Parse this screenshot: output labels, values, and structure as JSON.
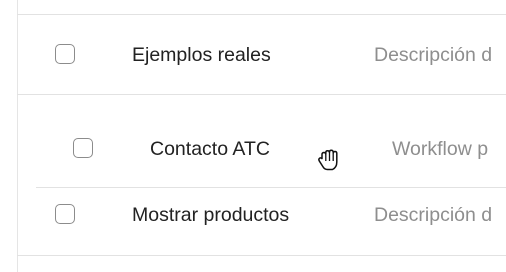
{
  "rows": [
    {
      "title": "Ejemplos reales",
      "description": "Descripción d"
    },
    {
      "title": "Contacto ATC",
      "description": "Workflow p"
    },
    {
      "title": "Mostrar productos",
      "description": "Descripción d"
    }
  ],
  "cursor": {
    "icon": "grab-hand-icon"
  }
}
